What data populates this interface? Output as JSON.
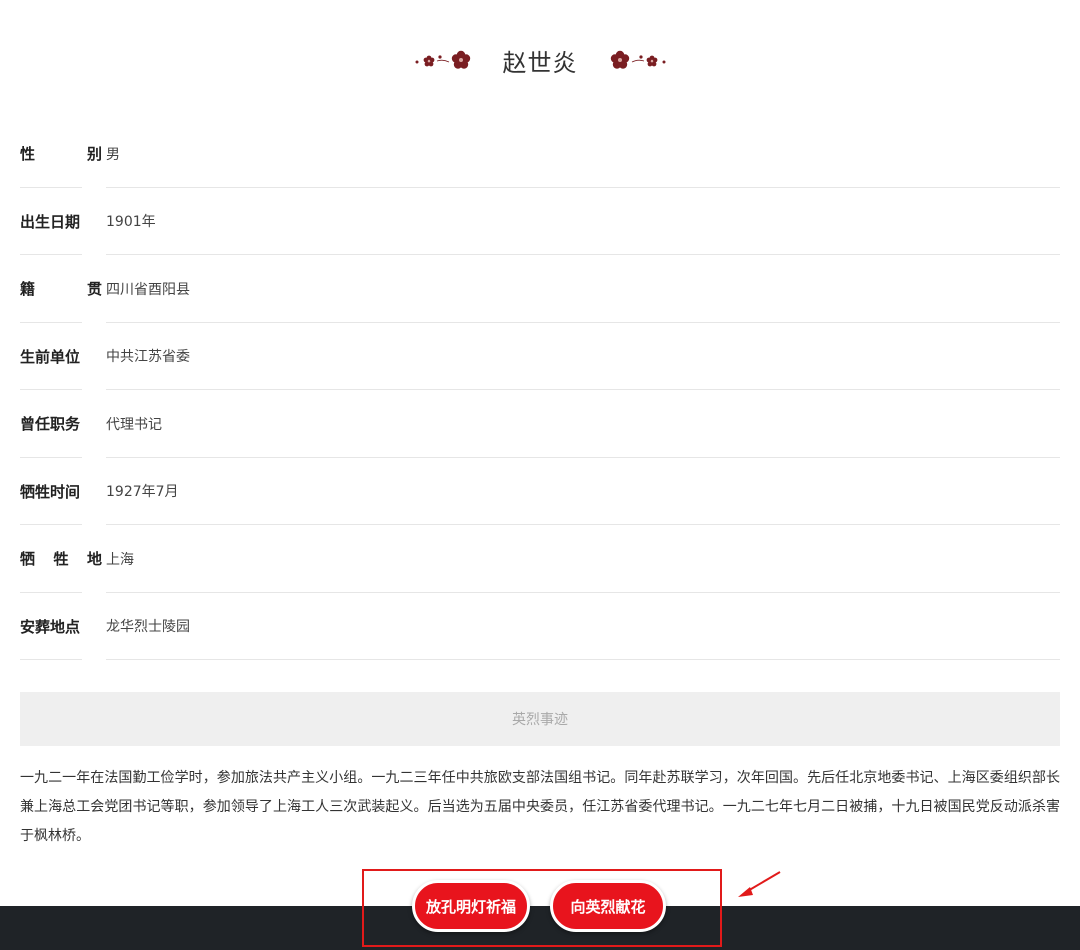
{
  "title": "赵世炎",
  "colors": {
    "accent_red": "#e8141d",
    "footer_dark": "#1f2327",
    "flower_red": "#7a1e22"
  },
  "info": [
    {
      "label": "性　别",
      "chars": [
        "性",
        "别"
      ],
      "value": "男"
    },
    {
      "label": "出生日期",
      "chars": [
        "出生日期"
      ],
      "value": "1901年"
    },
    {
      "label": "籍　贯",
      "chars": [
        "籍",
        "贯"
      ],
      "value": "四川省酉阳县"
    },
    {
      "label": "生前单位",
      "chars": [
        "生前单位"
      ],
      "value": "中共江苏省委"
    },
    {
      "label": "曾任职务",
      "chars": [
        "曾任职务"
      ],
      "value": "代理书记"
    },
    {
      "label": "牺牲时间",
      "chars": [
        "牺牲时间"
      ],
      "value": "1927年7月"
    },
    {
      "label": "牺 牲 地",
      "chars": [
        "牺",
        "牲",
        "地"
      ],
      "value": "上海"
    },
    {
      "label": "安葬地点",
      "chars": [
        "安葬地点"
      ],
      "value": "龙华烈士陵园"
    }
  ],
  "section_heading": "英烈事迹",
  "biography": "一九二一年在法国勤工俭学时，参加旅法共产主义小组。一九二三年任中共旅欧支部法国组书记。同年赴苏联学习，次年回国。先后任北京地委书记、上海区委组织部长兼上海总工会党团书记等职，参加领导了上海工人三次武装起义。后当选为五届中央委员，任江苏省委代理书记。一九二七年七月二日被捕，十九日被国民党反动派杀害于枫林桥。",
  "buttons": {
    "lantern": "放孔明灯祈福",
    "flowers": "向英烈献花"
  },
  "icons": [
    "plum-blossom-left-icon",
    "plum-blossom-right-icon",
    "annotation-arrow-icon"
  ]
}
